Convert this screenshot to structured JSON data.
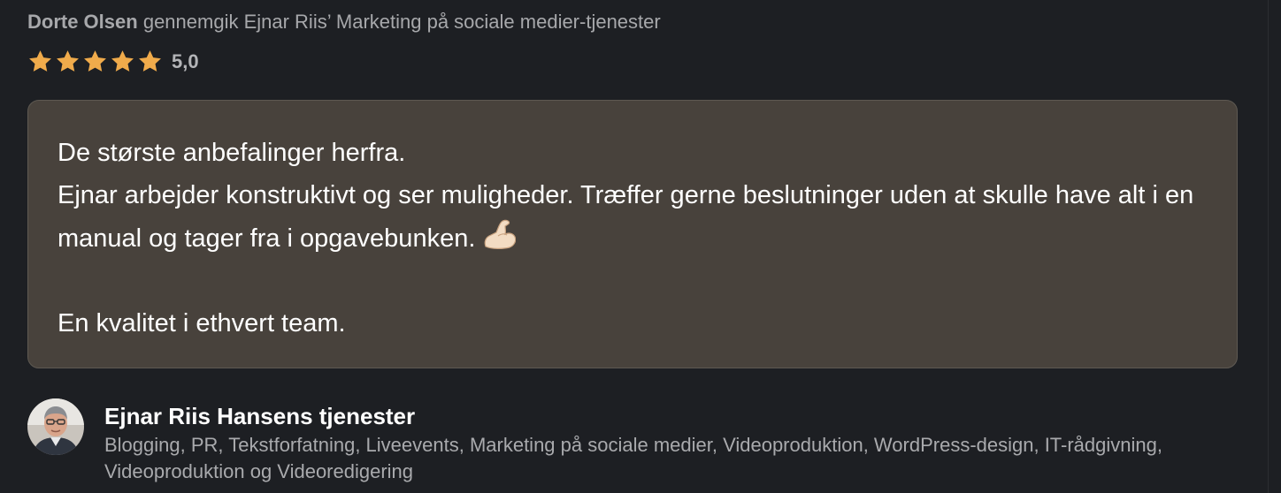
{
  "review": {
    "reviewer_name": "Dorte Olsen",
    "action_text": "gennemgik Ejnar Riis’ Marketing på sociale medier-tjenester",
    "rating": {
      "stars": 5,
      "max_stars": 5,
      "value_text": "5,0",
      "star_color": "#f0ab4b"
    },
    "body": {
      "line1": "De største anbefalinger herfra.",
      "line2": "Ejnar arbejder konstruktivt og ser muligheder. Træffer gerne beslutninger uden at skulle have alt i en manual og tager fra i opgavebunken.",
      "emoji_icon": "flexed-biceps-icon",
      "line3": "En kvalitet i ethvert team."
    }
  },
  "services": {
    "title": "Ejnar Riis Hansens tjenester",
    "list": "Blogging, PR, Tekstforfatning, Liveevents, Marketing på sociale medier, Videoproduktion, WordPress-design, IT-rådgivning, Videoproduktion og Videoredigering"
  },
  "colors": {
    "background": "#1d1f23",
    "review_box": "#48423c",
    "muted_text": "#a7a8ab",
    "accent_star": "#f0ab4b"
  }
}
